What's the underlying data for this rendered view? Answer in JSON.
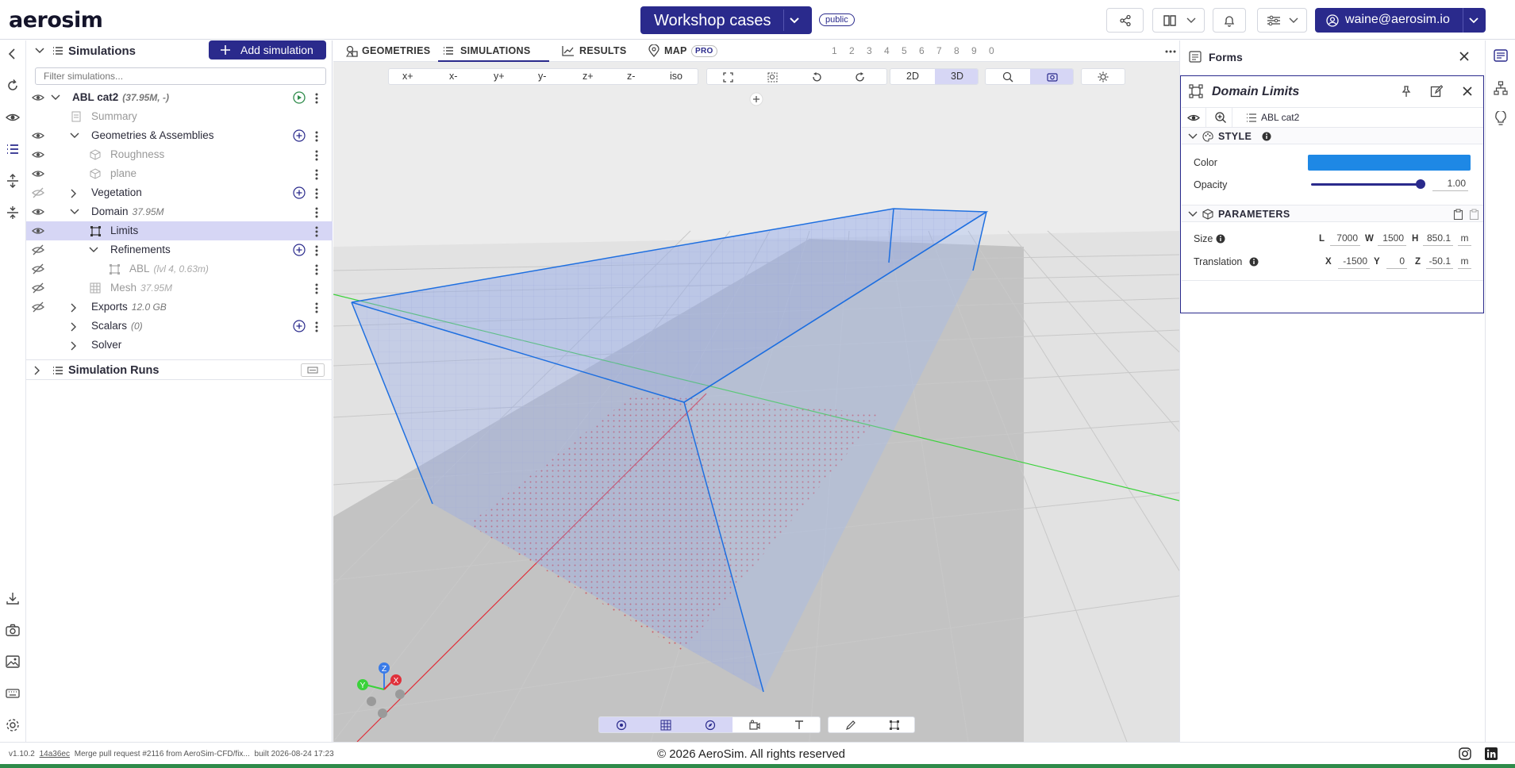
{
  "header": {
    "logo": "aerosim",
    "project": "Workshop cases",
    "visibility": "public",
    "user": "waine@aerosim.io"
  },
  "simulations": {
    "title": "Simulations",
    "add_label": "Add simulation",
    "filter_placeholder": "Filter simulations...",
    "tree": {
      "root": {
        "label": "ABL cat2",
        "meta": "(37.95M, -)"
      },
      "summary": "Summary",
      "geometries": "Geometries & Assemblies",
      "roughness": "Roughness",
      "plane": "plane",
      "vegetation": "Vegetation",
      "domain": {
        "label": "Domain",
        "meta": "37.95M"
      },
      "limits": "Limits",
      "refinements": "Refinements",
      "abl": {
        "label": "ABL",
        "meta": "(lvl 4, 0.63m)"
      },
      "mesh": {
        "label": "Mesh",
        "meta": "37.95M"
      },
      "exports": {
        "label": "Exports",
        "meta": "12.0 GB"
      },
      "scalars": {
        "label": "Scalars",
        "meta": "(0)"
      },
      "solver": "Solver"
    },
    "runs": "Simulation Runs"
  },
  "tabs": {
    "geometries": "GEOMETRIES",
    "simulations": "SIMULATIONS",
    "results": "RESULTS",
    "map": "MAP",
    "map_badge": "PRO",
    "numkeys": [
      "1",
      "2",
      "3",
      "4",
      "5",
      "6",
      "7",
      "8",
      "9",
      "0"
    ]
  },
  "view_toolbar": {
    "axes": [
      "x+",
      "x-",
      "y+",
      "y-",
      "z+",
      "z-",
      "iso"
    ],
    "mode_2d": "2D",
    "mode_3d": "3D"
  },
  "gizmo": {
    "z": "Z",
    "y": "Y",
    "x": "X"
  },
  "forms": {
    "title": "Forms",
    "card_title": "Domain Limits",
    "breadcrumb": "ABL cat2",
    "style": {
      "title": "STYLE",
      "color_label": "Color",
      "color_value": "#1e88e5",
      "opacity_label": "Opacity",
      "opacity_value": "1.00",
      "opacity_fraction": 1.0
    },
    "parameters": {
      "title": "PARAMETERS",
      "size_label": "Size",
      "size": {
        "L": "7000",
        "W": "1500",
        "H": "850.1",
        "unit": "m"
      },
      "translation_label": "Translation",
      "translation": {
        "X": "-1500",
        "Y": "0",
        "Z": "-50.1",
        "unit": "m"
      }
    }
  },
  "footer": {
    "version": "v1.10.2",
    "commit": "14a36ec",
    "message": "Merge pull request #2116 from AeroSim-CFD/fix...",
    "built": "built 2026-08-24 17:23",
    "copyright": "© 2026 AeroSim. All rights reserved"
  },
  "colors": {
    "accent": "#2a2a8c",
    "selection": "#d4d4f5",
    "domain_blue": "#1e6fe0"
  }
}
